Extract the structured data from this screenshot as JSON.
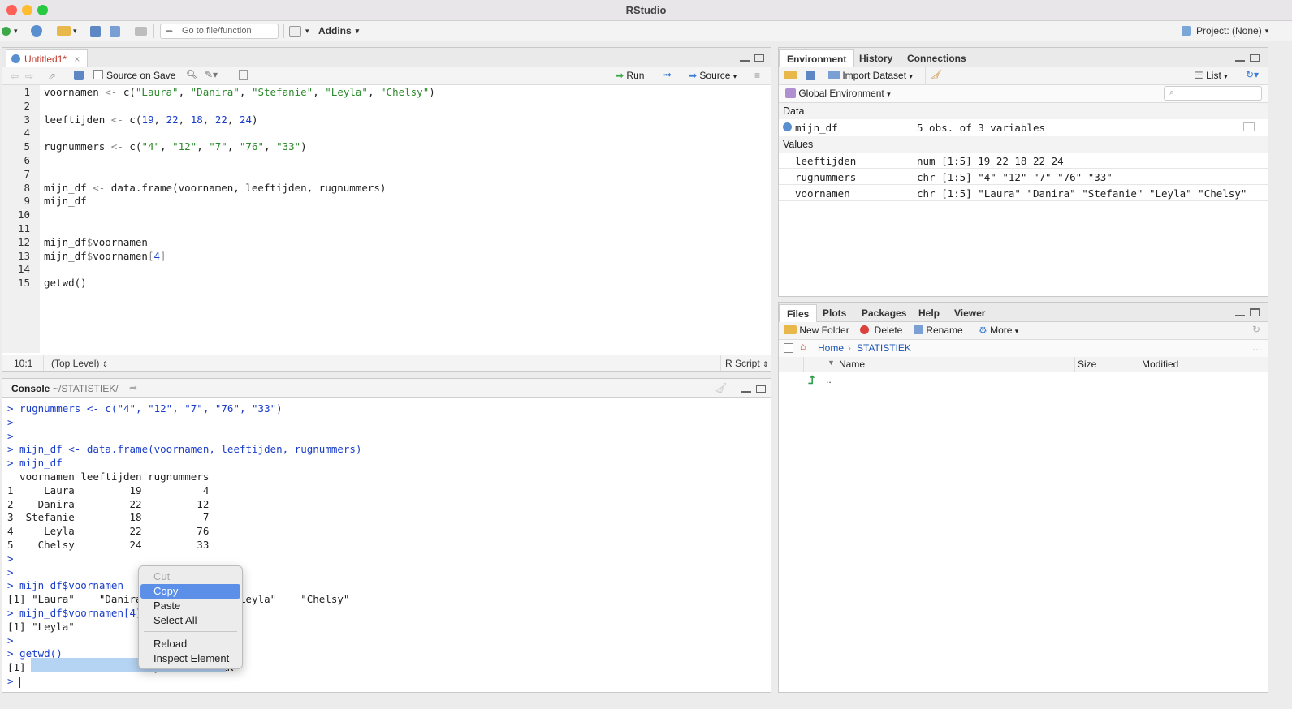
{
  "window": {
    "title": "RStudio"
  },
  "toolbar": {
    "goto_placeholder": "Go to file/function",
    "addins": "Addins",
    "project": "Project: (None)"
  },
  "editor": {
    "tab": "Untitled1*",
    "source_on_save": "Source on Save",
    "run": "Run",
    "source": "Source",
    "lines": [
      {
        "n": "1",
        "tokens": [
          [
            "voornamen ",
            ""
          ],
          [
            "<- ",
            "op"
          ],
          [
            "c(",
            ""
          ],
          [
            "\"Laura\"",
            "str"
          ],
          [
            ", ",
            ""
          ],
          [
            "\"Danira\"",
            "str"
          ],
          [
            ", ",
            ""
          ],
          [
            "\"Stefanie\"",
            "str"
          ],
          [
            ", ",
            ""
          ],
          [
            "\"Leyla\"",
            "str"
          ],
          [
            ", ",
            ""
          ],
          [
            "\"Chelsy\"",
            "str"
          ],
          [
            ")",
            ""
          ]
        ]
      },
      {
        "n": "2",
        "tokens": []
      },
      {
        "n": "3",
        "tokens": [
          [
            "leeftijden ",
            ""
          ],
          [
            "<- ",
            "op"
          ],
          [
            "c(",
            ""
          ],
          [
            "19",
            "num"
          ],
          [
            ", ",
            ""
          ],
          [
            "22",
            "num"
          ],
          [
            ", ",
            ""
          ],
          [
            "18",
            "num"
          ],
          [
            ", ",
            ""
          ],
          [
            "22",
            "num"
          ],
          [
            ", ",
            ""
          ],
          [
            "24",
            "num"
          ],
          [
            ")",
            ""
          ]
        ]
      },
      {
        "n": "4",
        "tokens": []
      },
      {
        "n": "5",
        "tokens": [
          [
            "rugnummers ",
            ""
          ],
          [
            "<- ",
            "op"
          ],
          [
            "c(",
            ""
          ],
          [
            "\"4\"",
            "str"
          ],
          [
            ", ",
            ""
          ],
          [
            "\"12\"",
            "str"
          ],
          [
            ", ",
            ""
          ],
          [
            "\"7\"",
            "str"
          ],
          [
            ", ",
            ""
          ],
          [
            "\"76\"",
            "str"
          ],
          [
            ", ",
            ""
          ],
          [
            "\"33\"",
            "str"
          ],
          [
            ")",
            ""
          ]
        ]
      },
      {
        "n": "6",
        "tokens": []
      },
      {
        "n": "7",
        "tokens": []
      },
      {
        "n": "8",
        "tokens": [
          [
            "mijn_df ",
            ""
          ],
          [
            "<- ",
            "op"
          ],
          [
            "data.frame(voornamen, leeftijden, rugnummers)",
            ""
          ]
        ]
      },
      {
        "n": "9",
        "tokens": [
          [
            "mijn_df",
            ""
          ]
        ]
      },
      {
        "n": "10",
        "tokens": []
      },
      {
        "n": "11",
        "tokens": []
      },
      {
        "n": "12",
        "tokens": [
          [
            "mijn_df",
            ""
          ],
          [
            "$",
            "op"
          ],
          [
            "voornamen",
            ""
          ]
        ]
      },
      {
        "n": "13",
        "tokens": [
          [
            "mijn_df",
            ""
          ],
          [
            "$",
            "op"
          ],
          [
            "voornamen",
            ""
          ],
          [
            "[",
            "op"
          ],
          [
            "4",
            "num"
          ],
          [
            "]",
            "op"
          ]
        ]
      },
      {
        "n": "14",
        "tokens": []
      },
      {
        "n": "15",
        "tokens": [
          [
            "getwd()",
            ""
          ]
        ]
      }
    ],
    "status_pos": "10:1",
    "status_scope": "(Top Level)",
    "status_type": "R Script"
  },
  "console": {
    "title": "Console",
    "path": "~/STATISTIEK/",
    "lines": [
      [
        "prompt",
        "> rugnummers <- c(\"4\", \"12\", \"7\", \"76\", \"33\")"
      ],
      [
        "prompt",
        ">"
      ],
      [
        "prompt",
        ">"
      ],
      [
        "prompt",
        "> mijn_df <- data.frame(voornamen, leeftijden, rugnummers)"
      ],
      [
        "prompt",
        "> mijn_df"
      ],
      [
        "out",
        "  voornamen leeftijden rugnummers"
      ],
      [
        "out",
        "1     Laura         19          4"
      ],
      [
        "out",
        "2    Danira         22         12"
      ],
      [
        "out",
        "3  Stefanie         18          7"
      ],
      [
        "out",
        "4     Leyla         22         76"
      ],
      [
        "out",
        "5    Chelsy         24         33"
      ],
      [
        "prompt",
        ">"
      ],
      [
        "prompt",
        ">"
      ],
      [
        "prompt",
        "> mijn_df$voornamen"
      ],
      [
        "out",
        "[1] \"Laura\"    \"Danira\"   \"Stefanie\" \"Leyla\"    \"Chelsy\""
      ],
      [
        "prompt",
        "> mijn_df$voornamen[4]"
      ],
      [
        "out",
        "[1] \"Leyla\""
      ],
      [
        "prompt",
        ">"
      ],
      [
        "prompt",
        "> getwd()"
      ],
      [
        "out",
        "[1] \"/Users/mariekefontеyn/STATISTIEK\""
      ],
      [
        "prompt",
        ">"
      ]
    ]
  },
  "context_menu": {
    "items": [
      "Cut",
      "Copy",
      "Paste",
      "Select All",
      "Reload",
      "Inspect Element"
    ]
  },
  "environment": {
    "tabs": [
      "Environment",
      "History",
      "Connections"
    ],
    "import": "Import Dataset",
    "list": "List",
    "scope": "Global Environment",
    "data_header": "Data",
    "values_header": "Values",
    "data": [
      {
        "name": "mijn_df",
        "value": "5 obs. of 3 variables"
      }
    ],
    "values": [
      {
        "name": "leeftijden",
        "value": "num [1:5] 19 22 18 22 24"
      },
      {
        "name": "rugnummers",
        "value": "chr [1:5] \"4\" \"12\" \"7\" \"76\" \"33\""
      },
      {
        "name": "voornamen",
        "value": "chr [1:5] \"Laura\" \"Danira\" \"Stefanie\" \"Leyla\" \"Chelsy\""
      }
    ]
  },
  "files": {
    "tabs": [
      "Files",
      "Plots",
      "Packages",
      "Help",
      "Viewer"
    ],
    "new_folder": "New Folder",
    "delete": "Delete",
    "rename": "Rename",
    "more": "More",
    "crumb_home": "Home",
    "crumb_dir": "STATISTIEK",
    "col_name": "Name",
    "col_size": "Size",
    "col_modified": "Modified",
    "parent": ".."
  }
}
